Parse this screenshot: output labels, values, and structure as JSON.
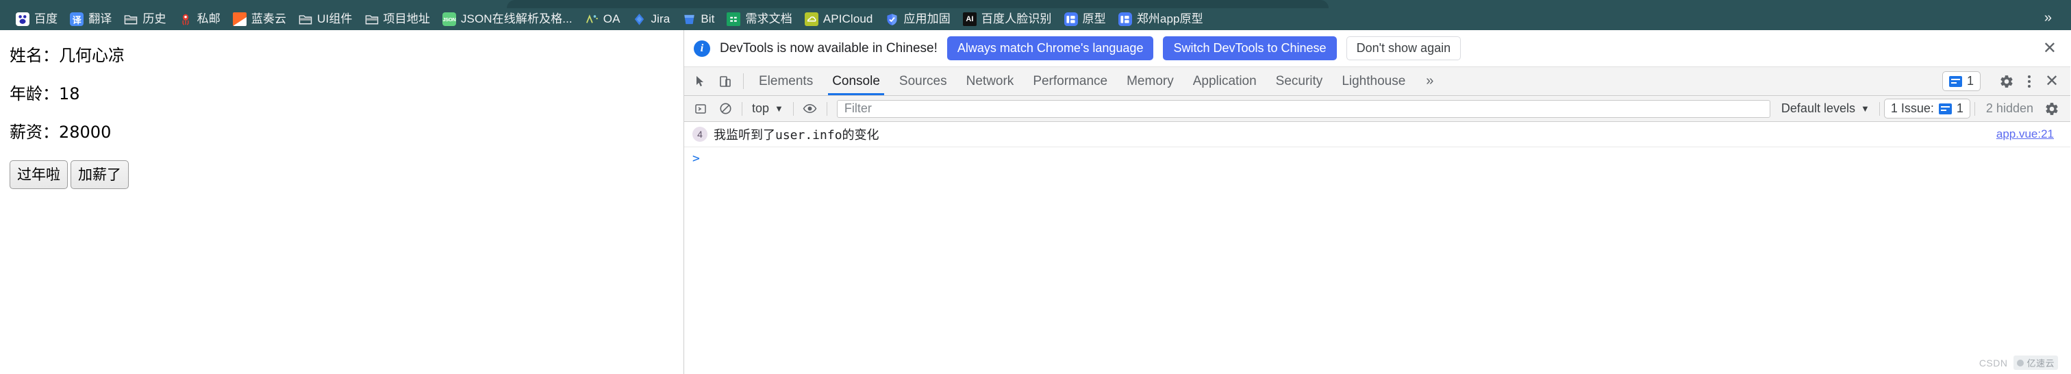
{
  "browser": {
    "bookmarks": [
      {
        "label": "百度",
        "icon": "baidu-icon"
      },
      {
        "label": "翻译",
        "icon": "translate-icon"
      },
      {
        "label": "历史",
        "icon": "folder-icon"
      },
      {
        "label": "私邮",
        "icon": "mail-icon"
      },
      {
        "label": "蓝奏云",
        "icon": "lanzou-icon"
      },
      {
        "label": "UI组件",
        "icon": "folder-icon"
      },
      {
        "label": "项目地址",
        "icon": "folder-icon"
      },
      {
        "label": "JSON在线解析及格...",
        "icon": "json-icon"
      },
      {
        "label": "OA",
        "icon": "oa-icon"
      },
      {
        "label": "Jira",
        "icon": "jira-icon"
      },
      {
        "label": "Bit",
        "icon": "bit-icon"
      },
      {
        "label": "需求文档",
        "icon": "doc-icon"
      },
      {
        "label": "APICloud",
        "icon": "apicloud-icon"
      },
      {
        "label": "应用加固",
        "icon": "shield-icon"
      },
      {
        "label": "百度人脸识别",
        "icon": "ai-icon"
      },
      {
        "label": "原型",
        "icon": "prototype-icon"
      },
      {
        "label": "郑州app原型",
        "icon": "prototype-icon"
      }
    ],
    "overflow_label": "»",
    "bookmark_bar_bg": "#2c5359"
  },
  "web_page": {
    "fields": [
      "姓名：几何心凉",
      "年龄：18",
      "薪资：28000"
    ],
    "buttons": [
      "过年啦",
      "加薪了"
    ]
  },
  "devtools": {
    "banner": {
      "icon": "info-icon",
      "message": "DevTools is now available in Chinese!",
      "primary_button_1": "Always match Chrome's language",
      "primary_button_2": "Switch DevTools to Chinese",
      "secondary_button": "Don't show again",
      "close_label": "✕",
      "primary_color": "#4a6cf0"
    },
    "tabs": [
      {
        "label": "Elements",
        "active": false
      },
      {
        "label": "Console",
        "active": true
      },
      {
        "label": "Sources",
        "active": false
      },
      {
        "label": "Network",
        "active": false
      },
      {
        "label": "Performance",
        "active": false
      },
      {
        "label": "Memory",
        "active": false
      },
      {
        "label": "Application",
        "active": false
      },
      {
        "label": "Security",
        "active": false
      },
      {
        "label": "Lighthouse",
        "active": false
      }
    ],
    "tab_overflow": "»",
    "toolbar_icons": {
      "inspect": "inspect-element-icon",
      "device": "device-toolbar-icon"
    },
    "tabbar_right": {
      "issues_count": "1",
      "settings": "gear-icon",
      "more": "kebab-menu-icon",
      "close": "close-icon"
    },
    "console_toolbar": {
      "clear": "clear-console-icon",
      "no_entry": "no-entry-icon",
      "context": "top",
      "context_caret": "▼",
      "eye": "eye-icon",
      "filter_placeholder": "Filter",
      "filter_value": "",
      "levels_label": "Default levels",
      "levels_caret": "▼",
      "issue_label": "1 Issue:",
      "issue_count": "1",
      "hidden_label": "2 hidden",
      "settings": "gear-icon"
    },
    "console_messages": [
      {
        "count": "4",
        "text": "我监听到了user.info的变化",
        "source": "app.vue:21"
      }
    ],
    "prompt_caret": ">",
    "active_tab_underline_color": "#1a73e8"
  },
  "watermark": {
    "label": "CSDN",
    "chip_label": "亿速云"
  }
}
